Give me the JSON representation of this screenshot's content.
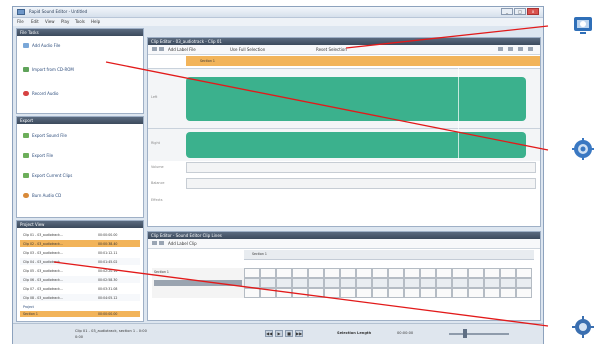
{
  "window": {
    "title": "Rapid Sound Editor - Untitled"
  },
  "window_controls": {
    "minimize": "_",
    "maximize": "□",
    "close": "x"
  },
  "menu": [
    "File",
    "Edit",
    "View",
    "Play",
    "Tools",
    "Help"
  ],
  "file_tasks": {
    "header": "File Tasks",
    "items": [
      "Add Audio File",
      "Import from CD-ROM",
      "Record Audio"
    ]
  },
  "export": {
    "header": "Export",
    "items": [
      "Export Sound File",
      "Export File",
      "Export Current Clips",
      "Burn Audio CD"
    ]
  },
  "project_view": {
    "header": "Project View",
    "rows": [
      [
        "Clip 01 - 03_audiotrack...",
        "00:00:00.00"
      ],
      [
        "Clip 02 - 03_audiotrack...",
        "00:00:38.40"
      ],
      [
        "Clip 03 - 03_audiotrack...",
        "00:01:12.11"
      ],
      [
        "Clip 04 - 03_audiotrack...",
        "00:01:45.02"
      ],
      [
        "Clip 05 - 03_audiotrack...",
        "00:02:20.16"
      ],
      [
        "Clip 06 - 03_audiotrack...",
        "00:02:58.30"
      ],
      [
        "Clip 07 - 03_audiotrack...",
        "00:03:31.08"
      ],
      [
        "Clip 08 - 03_audiotrack...",
        "00:04:05.12"
      ]
    ],
    "group_label": "Project",
    "selected_row": [
      "Section 1",
      "00:00:00.00"
    ]
  },
  "clip_editor": {
    "header": "Clip Editor - 03_audiotrack - Clip 01",
    "toolbar_items": [
      "Add Label File",
      "Use Full Selection",
      "Reset Selection"
    ],
    "section_label": "Section 1",
    "lane_labels": [
      "Left",
      "Right",
      "Volume",
      "Balance",
      "Effects"
    ]
  },
  "clip_list": {
    "header": "Clip Editor - Sound Editor Clip Lines",
    "toolbar_items": [
      "Add Label Clip"
    ],
    "col_label": "Section 1",
    "row_label": "Section 1"
  },
  "status": {
    "file_text": "Clip 01 - 03_audiotrack, section 1 - 0:00",
    "file_sub": "0:00",
    "selection_label": "Selection Length",
    "selection_value": "00:00:00",
    "play_symbols": [
      "◀◀",
      "▶",
      "■",
      "▶▶"
    ]
  },
  "callouts": [
    {
      "icon": "screen-selection-icon",
      "color": "#2f6fb8"
    },
    {
      "icon": "audio-gear-icon",
      "color": "#3a78c2"
    },
    {
      "icon": "settings-gear-icon",
      "color": "#3a6fb0"
    }
  ],
  "colors": {
    "waveform": "#3bb18d",
    "selection_bar": "#f2b45a",
    "callout_line": "#e21a1a",
    "panel_header": "#4a586b"
  }
}
